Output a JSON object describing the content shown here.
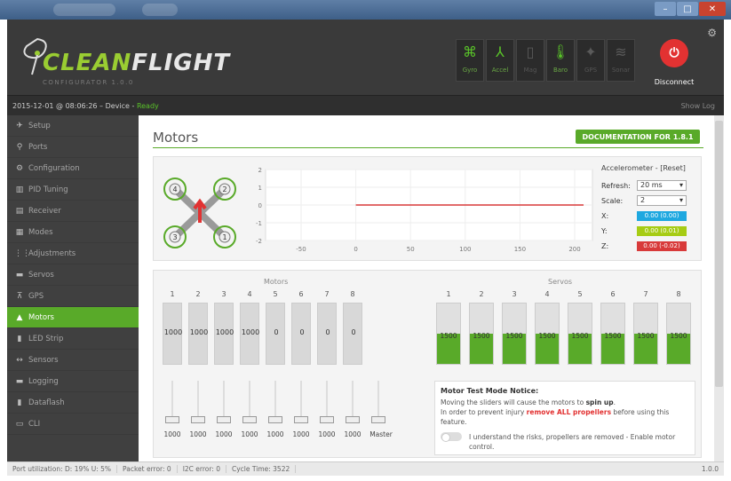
{
  "window": {
    "min": "–",
    "max": "□",
    "close": "✕"
  },
  "header": {
    "logo_part1": "CLEAN",
    "logo_part2": "FLIGHT",
    "logo_sub": "CONFIGURATOR 1.0.0",
    "sensors": [
      {
        "name": "gyro",
        "label": "Gyro",
        "glyph": "⌘",
        "active": true
      },
      {
        "name": "accel",
        "label": "Accel",
        "glyph": "⅄",
        "active": true
      },
      {
        "name": "mag",
        "label": "Mag",
        "glyph": "▯",
        "active": false
      },
      {
        "name": "baro",
        "label": "Baro",
        "glyph": "🌡",
        "active": true
      },
      {
        "name": "gps",
        "label": "GPS",
        "glyph": "✦",
        "active": false
      },
      {
        "name": "sonar",
        "label": "Sonar",
        "glyph": "≋",
        "active": false
      }
    ],
    "disconnect_label": "Disconnect",
    "gear_icon": "gear-icon"
  },
  "status": {
    "timestamp": "2015-12-01 @ 08:06:26 – Device - ",
    "state": "Ready",
    "show_log": "Show Log"
  },
  "sidebar": {
    "items": [
      {
        "label": "Setup",
        "icon": "✈",
        "active": false
      },
      {
        "label": "Ports",
        "icon": "⚲",
        "active": false
      },
      {
        "label": "Configuration",
        "icon": "⚙",
        "active": false
      },
      {
        "label": "PID Tuning",
        "icon": "▥",
        "active": false
      },
      {
        "label": "Receiver",
        "icon": "▤",
        "active": false
      },
      {
        "label": "Modes",
        "icon": "▦",
        "active": false
      },
      {
        "label": "Adjustments",
        "icon": "⋮⋮",
        "active": false
      },
      {
        "label": "Servos",
        "icon": "▬",
        "active": false
      },
      {
        "label": "GPS",
        "icon": "⊼",
        "active": false
      },
      {
        "label": "Motors",
        "icon": "▲",
        "active": true
      },
      {
        "label": "LED Strip",
        "icon": "▮",
        "active": false
      },
      {
        "label": "Sensors",
        "icon": "↔",
        "active": false
      },
      {
        "label": "Logging",
        "icon": "▬",
        "active": false
      },
      {
        "label": "Dataflash",
        "icon": "▮",
        "active": false
      },
      {
        "label": "CLI",
        "icon": "▭",
        "active": false
      }
    ]
  },
  "main": {
    "title": "Motors",
    "doc_button": "DOCUMENTATION FOR 1.8.1",
    "graph": {
      "y_ticks": [
        "2",
        "1",
        "0",
        "-1",
        "-2"
      ],
      "x_ticks": [
        "-50",
        "0",
        "50",
        "100",
        "150",
        "200"
      ]
    },
    "accelerometer": {
      "title": "Accelerometer - [Reset]",
      "refresh_label": "Refresh:",
      "refresh_value": "20 ms",
      "scale_label": "Scale:",
      "scale_value": "2",
      "x_label": "X:",
      "x_value": "0.00 (0.00)",
      "x_color": "#1ea8e0",
      "y_label": "Y:",
      "y_value": "0.00 (0.01)",
      "y_color": "#a6cc14",
      "z_label": "Z:",
      "z_value": "0.00 (-0.02)",
      "z_color": "#d83a3a"
    },
    "motors": {
      "title": "Motors",
      "numbers": [
        "1",
        "2",
        "3",
        "4",
        "5",
        "6",
        "7",
        "8"
      ],
      "values": [
        "1000",
        "1000",
        "1000",
        "1000",
        "0",
        "0",
        "0",
        "0"
      ],
      "slider_values": [
        "1000",
        "1000",
        "1000",
        "1000",
        "1000",
        "1000",
        "1000",
        "1000"
      ],
      "master_label": "Master"
    },
    "servos": {
      "title": "Servos",
      "numbers": [
        "1",
        "2",
        "3",
        "4",
        "5",
        "6",
        "7",
        "8"
      ],
      "values": [
        "1500",
        "1500",
        "1500",
        "1500",
        "1500",
        "1500",
        "1500",
        "1500"
      ],
      "fill_fraction": 0.5
    },
    "notice": {
      "title": "Motor Test Mode Notice:",
      "line1_pre": "Moving the sliders will cause the motors to ",
      "line1_bold": "spin up",
      "line2_pre": "In order to prevent injury ",
      "line2_red": "remove ALL propellers",
      "line2_post": " before using this feature.",
      "toggle_label": "I understand the risks, propellers are removed - Enable motor control."
    }
  },
  "bottom": {
    "port_util": "Port utilization: D: 19% U: 5%",
    "packet_error": "Packet error: 0",
    "i2c_error": "I2C error: 0",
    "cycle_time": "Cycle Time: 3522",
    "version": "1.0.0"
  }
}
